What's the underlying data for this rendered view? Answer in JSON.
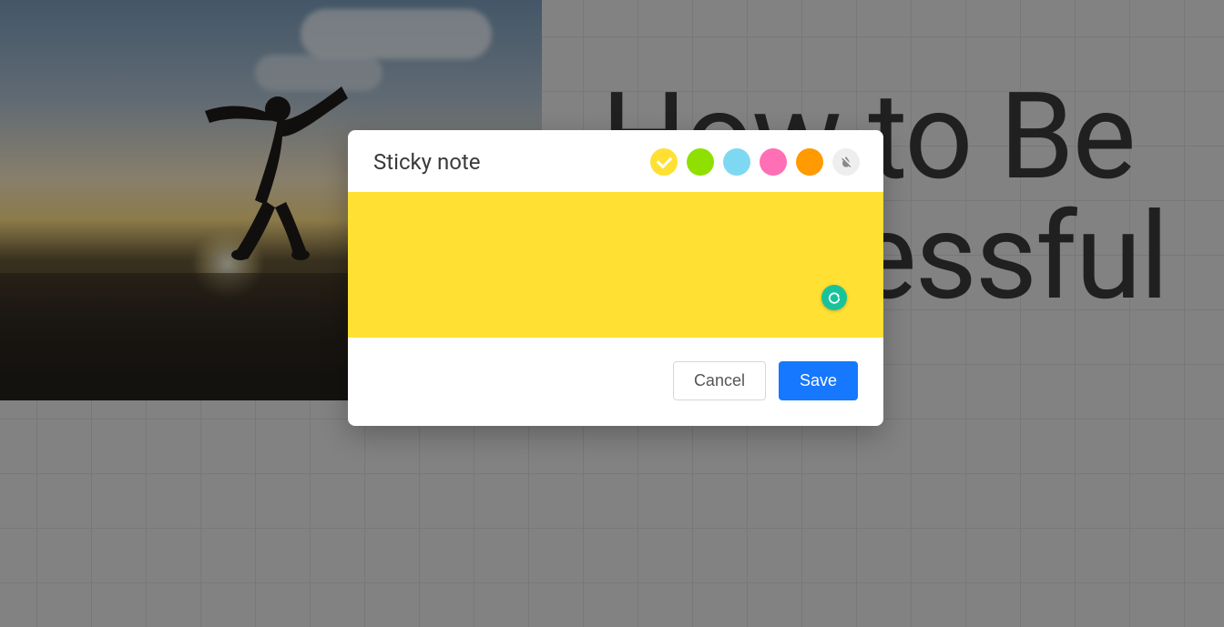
{
  "background": {
    "title_line1": "How to Be",
    "title_line2": "essful"
  },
  "modal": {
    "title": "Sticky note",
    "note_text": "",
    "placeholder": "",
    "colors": {
      "yellow": "#ffe033",
      "green": "#8fe000",
      "cyan": "#7fd8f2",
      "pink": "#ff6fb5",
      "orange": "#ff9a00",
      "none": "none"
    },
    "selected_color": "yellow",
    "buttons": {
      "cancel": "Cancel",
      "save": "Save"
    },
    "grammarly_label": "G"
  }
}
